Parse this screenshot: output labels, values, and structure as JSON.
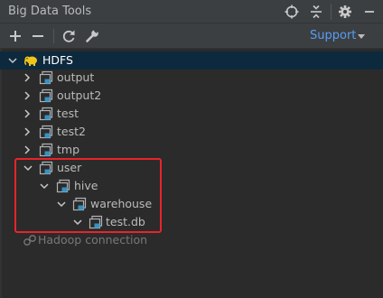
{
  "window": {
    "title": "Big Data Tools"
  },
  "titlebar_icons": [
    "crosshair-icon",
    "collapse-icon",
    "gear-icon",
    "minimize-icon"
  ],
  "toolbar": {
    "icons": [
      "plus-icon",
      "minus-icon",
      "refresh-icon",
      "wrench-icon"
    ],
    "support_label": "Support"
  },
  "tree": {
    "root": {
      "label": "HDFS",
      "expanded": true,
      "icon": "hadoop-elephant-icon",
      "selected": true
    },
    "folders": [
      {
        "label": "output",
        "expanded": false
      },
      {
        "label": "output2",
        "expanded": false
      },
      {
        "label": "test",
        "expanded": false
      },
      {
        "label": "test2",
        "expanded": false
      },
      {
        "label": "tmp",
        "expanded": false
      },
      {
        "label": "user",
        "expanded": true
      },
      {
        "label": "hive",
        "expanded": true
      },
      {
        "label": "warehouse",
        "expanded": true
      },
      {
        "label": "test.db",
        "expanded": true
      }
    ],
    "connection_hint": "Hadoop connection"
  },
  "colors": {
    "background": "#2b2b2b",
    "panel": "#3c3f41",
    "selection": "#0d293e",
    "accent_link": "#589df6",
    "highlight_box": "#e8242a",
    "folder_icon_blue": "#3592c4"
  }
}
